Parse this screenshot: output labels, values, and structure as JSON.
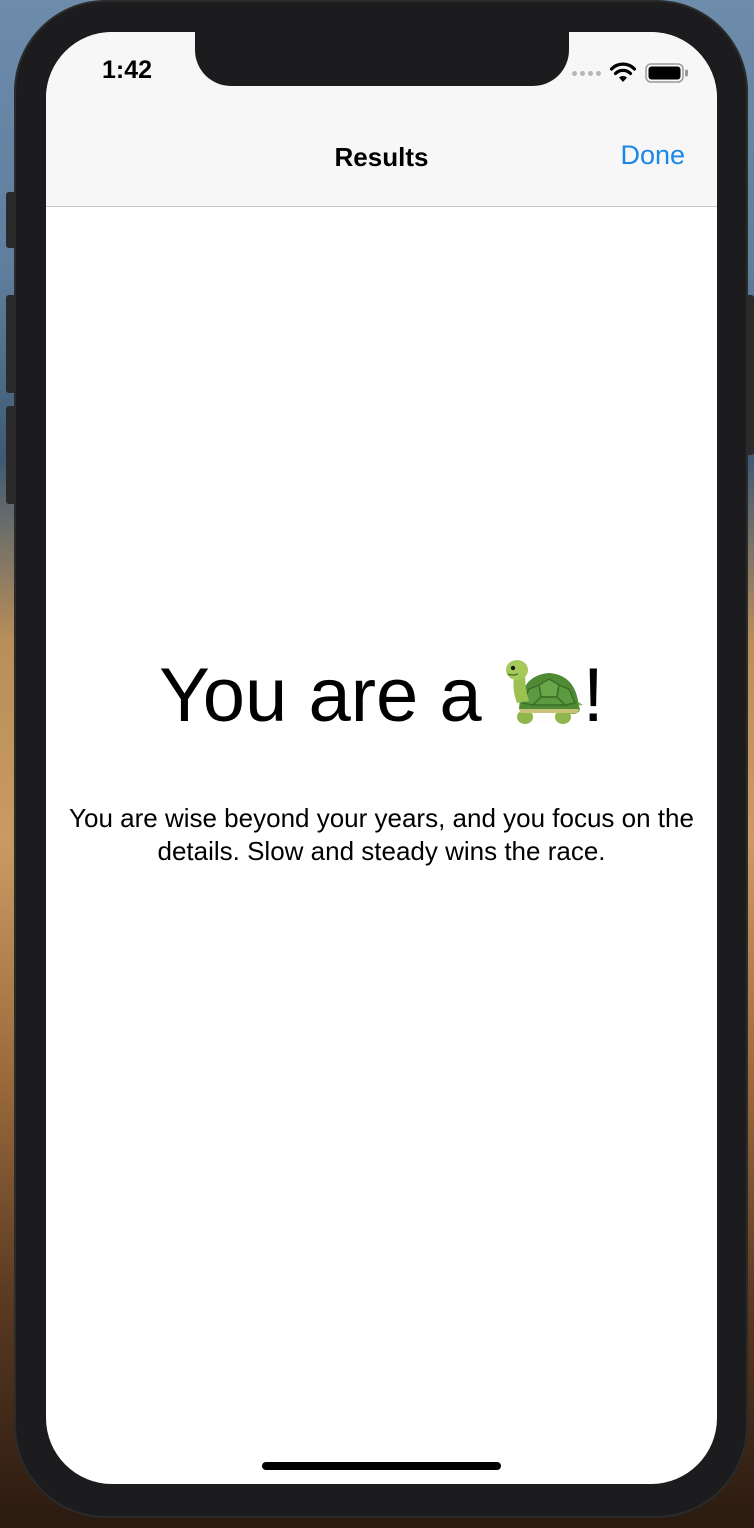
{
  "status_bar": {
    "time": "1:42"
  },
  "nav": {
    "title": "Results",
    "done_label": "Done"
  },
  "result": {
    "heading_prefix": "You are a ",
    "emoji_icon": "turtle-icon",
    "heading_suffix": "!",
    "description": "You are wise beyond your years, and you focus on the details. Slow and steady wins the race."
  },
  "colors": {
    "accent": "#1a86e6",
    "nav_background": "#f7f7f7"
  }
}
